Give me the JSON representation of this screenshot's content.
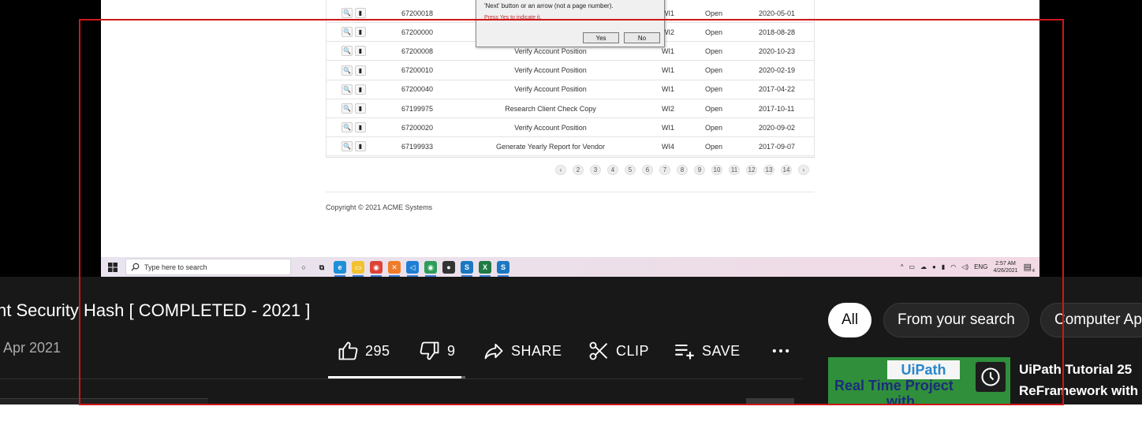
{
  "dialog": {
    "message_line1": "'Next' button or an arrow (not a page number).",
    "message_line2": "Press Yes to indicate it.",
    "yes_label": "Yes",
    "no_label": "No"
  },
  "work_items": [
    {
      "id": "67200018",
      "description": "",
      "wi": "WI1",
      "status": "Open",
      "date": "2020-05-01"
    },
    {
      "id": "67200000",
      "description": "",
      "wi": "WI2",
      "status": "Open",
      "date": "2018-08-28"
    },
    {
      "id": "67200008",
      "description": "Verify Account Position",
      "wi": "WI1",
      "status": "Open",
      "date": "2020-10-23"
    },
    {
      "id": "67200010",
      "description": "Verify Account Position",
      "wi": "WI1",
      "status": "Open",
      "date": "2020-02-19"
    },
    {
      "id": "67200040",
      "description": "Verify Account Position",
      "wi": "WI1",
      "status": "Open",
      "date": "2017-04-22"
    },
    {
      "id": "67199975",
      "description": "Research Client Check Copy",
      "wi": "WI2",
      "status": "Open",
      "date": "2017-10-11"
    },
    {
      "id": "67200020",
      "description": "Verify Account Position",
      "wi": "WI1",
      "status": "Open",
      "date": "2020-09-02"
    },
    {
      "id": "67199933",
      "description": "Generate Yearly Report for Vendor",
      "wi": "WI4",
      "status": "Open",
      "date": "2017-09-07"
    }
  ],
  "pagination": {
    "prev": "‹",
    "pages": [
      "2",
      "3",
      "4",
      "5",
      "6",
      "7",
      "8",
      "9",
      "10",
      "11",
      "12",
      "13",
      "14"
    ],
    "next": "›"
  },
  "footer": {
    "copyright": "Copyright © 2021 ACME Systems"
  },
  "taskbar": {
    "search_placeholder": "Type here to search",
    "apps": [
      "cortana-icon",
      "task-view-icon",
      "edge-icon",
      "file-explorer-icon",
      "chrome-icon",
      "xampp-icon",
      "vscode-icon",
      "chrome-profile-icon",
      "obs-icon",
      "uipath-studio-icon",
      "excel-icon",
      "uipath-assistant-icon"
    ],
    "language": "ENG",
    "time": "2:57 AM",
    "date": "4/26/2021",
    "notification_count": "4"
  },
  "youtube": {
    "video_title": "nt Security Hash [ COMPLETED - 2021 ]",
    "upload_date": "Apr 2021",
    "likes": "295",
    "dislikes": "9",
    "share_label": "SHARE",
    "clip_label": "CLIP",
    "save_label": "SAVE",
    "like_ratio": 0.97,
    "chips": [
      "All",
      "From your search",
      "Computer Ap"
    ],
    "recommended": {
      "title_line1": "UiPath Tutorial 25",
      "title_line2": "ReFramework with",
      "thumb_text1": "UiPath",
      "thumb_text2": "Real Time Project",
      "thumb_text3": "with"
    }
  },
  "colors": {
    "accent_red": "#d01717",
    "yt_bg": "#181818",
    "chip_active_bg": "#ffffff",
    "chip_bg": "#272727"
  }
}
